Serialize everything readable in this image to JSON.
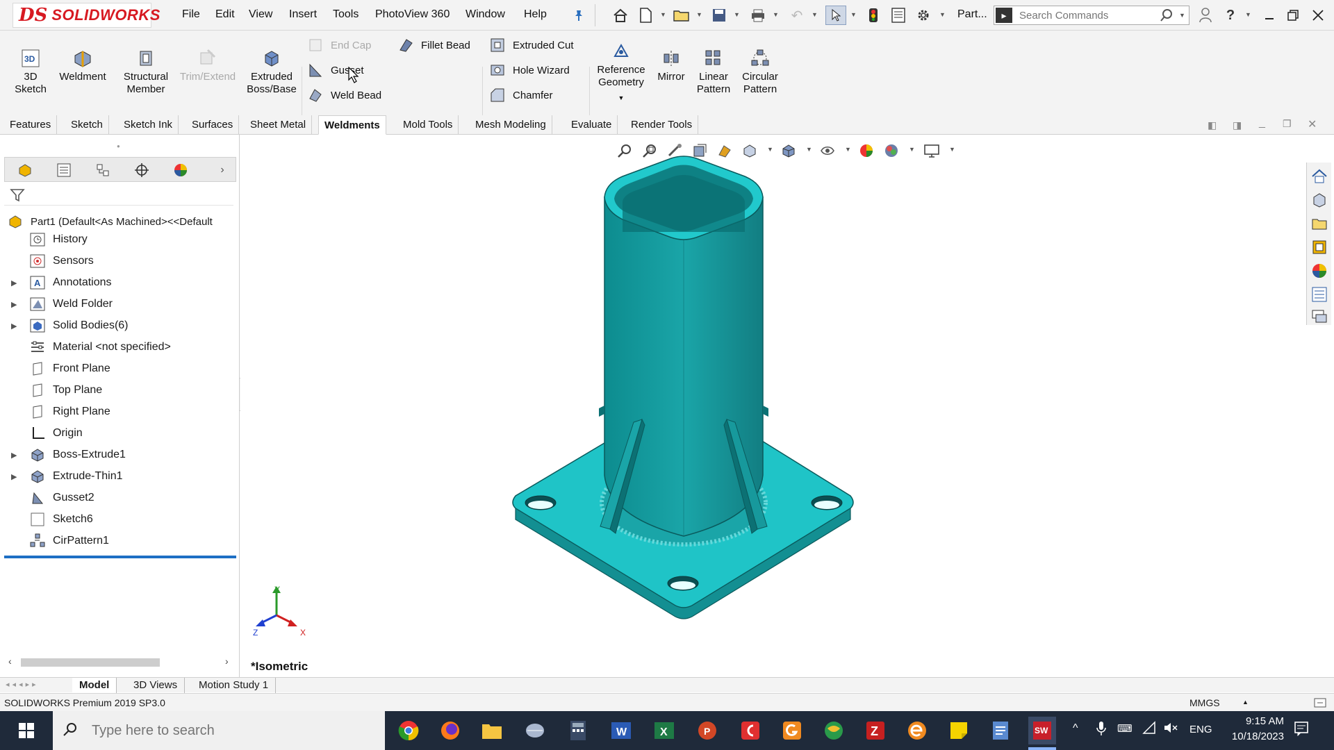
{
  "app": {
    "logo_mark": "DS",
    "logo_text": "SOLIDWORKS",
    "menus": [
      "File",
      "Edit",
      "View",
      "Insert",
      "Tools",
      "PhotoView 360",
      "Window",
      "Help"
    ],
    "doc_label": "Part...",
    "search_placeholder": "Search Commands",
    "pin_icon": "pin-icon"
  },
  "ribbon": {
    "sketch_3d": "3D\nSketch",
    "weldment": "Weldment",
    "structural_member": "Structural\nMember",
    "trim_extend": "Trim/Extend",
    "extruded_boss": "Extruded\nBoss/Base",
    "end_cap": "End Cap",
    "gusset": "Gusset",
    "weld_bead": "Weld Bead",
    "fillet_bead": "Fillet Bead",
    "extruded_cut": "Extruded Cut",
    "hole_wizard": "Hole Wizard",
    "chamfer": "Chamfer",
    "reference_geometry": "Reference\nGeometry",
    "mirror": "Mirror",
    "linear_pattern": "Linear\nPattern",
    "circular_pattern": "Circular\nPattern"
  },
  "tabs": [
    {
      "label": "Features",
      "active": false
    },
    {
      "label": "Sketch",
      "active": false
    },
    {
      "label": "Sketch Ink",
      "active": false
    },
    {
      "label": "Surfaces",
      "active": false
    },
    {
      "label": "Sheet Metal",
      "active": false
    },
    {
      "label": "Weldments",
      "active": true
    },
    {
      "label": "Mold Tools",
      "active": false
    },
    {
      "label": "Mesh Modeling",
      "active": false
    },
    {
      "label": "Evaluate",
      "active": false
    },
    {
      "label": "Render Tools",
      "active": false
    }
  ],
  "tree": {
    "root": "Part1  (Default<As Machined><<Default",
    "items": [
      {
        "label": "History",
        "expandable": false,
        "icon": "history-icon"
      },
      {
        "label": "Sensors",
        "expandable": false,
        "icon": "sensors-icon"
      },
      {
        "label": "Annotations",
        "expandable": true,
        "icon": "annotations-icon"
      },
      {
        "label": "Weld Folder",
        "expandable": true,
        "icon": "weld-folder-icon"
      },
      {
        "label": "Solid Bodies(6)",
        "expandable": true,
        "icon": "solid-bodies-icon"
      },
      {
        "label": "Material <not specified>",
        "expandable": false,
        "icon": "material-icon"
      },
      {
        "label": "Front Plane",
        "expandable": false,
        "icon": "plane-icon"
      },
      {
        "label": "Top Plane",
        "expandable": false,
        "icon": "plane-icon"
      },
      {
        "label": "Right Plane",
        "expandable": false,
        "icon": "plane-icon"
      },
      {
        "label": "Origin",
        "expandable": false,
        "icon": "origin-icon"
      },
      {
        "label": "Boss-Extrude1",
        "expandable": true,
        "icon": "extrude-icon"
      },
      {
        "label": "Extrude-Thin1",
        "expandable": true,
        "icon": "extrude-icon"
      },
      {
        "label": "Gusset2",
        "expandable": false,
        "icon": "gusset-icon"
      },
      {
        "label": "Sketch6",
        "expandable": false,
        "icon": "sketch-icon"
      },
      {
        "label": "CirPattern1",
        "expandable": false,
        "icon": "circular-pattern-icon"
      }
    ]
  },
  "viewport": {
    "view_label": "*Isometric",
    "model_color": "#1aa5a8",
    "axis_x": "X",
    "axis_y": "Y",
    "axis_z": "Z"
  },
  "bottom_tabs": [
    {
      "label": "Model",
      "active": true
    },
    {
      "label": "3D Views",
      "active": false
    },
    {
      "label": "Motion Study 1",
      "active": false
    }
  ],
  "status": {
    "version": "SOLIDWORKS Premium 2019 SP3.0",
    "units": "MMGS"
  },
  "taskbar": {
    "search_placeholder": "Type here to search",
    "language": "ENG",
    "time": "9:15 AM",
    "date": "10/18/2023"
  }
}
